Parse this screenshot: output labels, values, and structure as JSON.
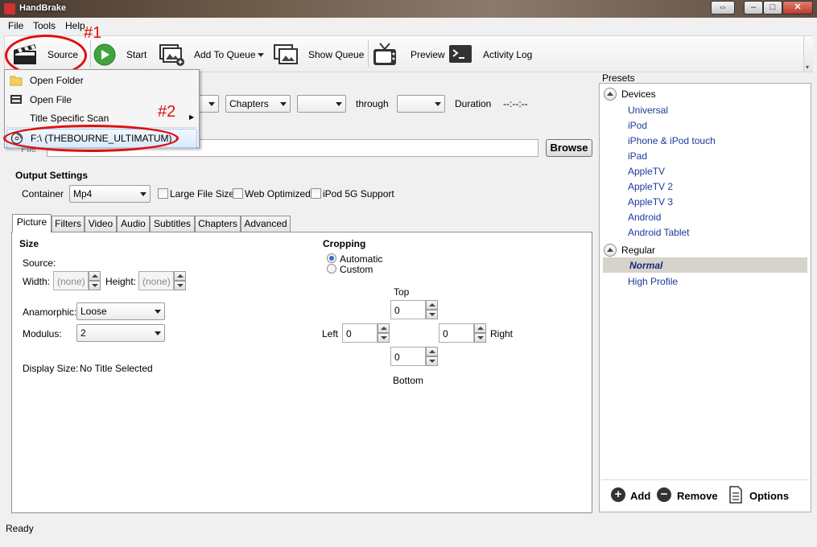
{
  "window": {
    "title": "HandBrake"
  },
  "menubar": {
    "items": [
      "File",
      "Tools",
      "Help"
    ]
  },
  "toolbar": {
    "source": "Source",
    "start": "Start",
    "add_to_queue": "Add To Queue",
    "show_queue": "Show Queue",
    "preview": "Preview",
    "activity_log": "Activity Log"
  },
  "annotations": {
    "one": "#1",
    "two": "#2"
  },
  "source_menu": {
    "open_folder": "Open Folder",
    "open_file": "Open File",
    "title_scan": "Title Specific Scan",
    "drive": "F:\\ (THEBOURNE_ULTIMATUM)"
  },
  "source_row": {
    "chapters": "Chapters",
    "through": "through",
    "duration_label": "Duration",
    "duration_value": "--:--:--"
  },
  "destination": {
    "label": "File",
    "browse": "Browse"
  },
  "output": {
    "heading": "Output Settings",
    "container_label": "Container",
    "container_value": "Mp4",
    "large_file": "Large File Size",
    "web_optimized": "Web Optimized",
    "ipod": "iPod 5G Support"
  },
  "tabs": [
    "Picture",
    "Filters",
    "Video",
    "Audio",
    "Subtitles",
    "Chapters",
    "Advanced"
  ],
  "picture": {
    "size_heading": "Size",
    "source_label": "Source:",
    "width_label": "Width:",
    "width_value": "(none)",
    "height_label": "Height:",
    "height_value": "(none)",
    "anamorphic_label": "Anamorphic:",
    "anamorphic_value": "Loose",
    "modulus_label": "Modulus:",
    "modulus_value": "2",
    "display_size_label": "Display Size:",
    "display_size_value": "No Title Selected"
  },
  "cropping": {
    "heading": "Cropping",
    "automatic": "Automatic",
    "custom": "Custom",
    "top_label": "Top",
    "top_value": "0",
    "left_label": "Left",
    "left_value": "0",
    "right_label": "Right",
    "right_value": "0",
    "bottom_label": "Bottom",
    "bottom_value": "0"
  },
  "presets": {
    "heading": "Presets",
    "devices_group": "Devices",
    "devices": [
      "Universal",
      "iPod",
      "iPhone & iPod touch",
      "iPad",
      "AppleTV",
      "AppleTV 2",
      "AppleTV 3",
      "Android",
      "Android Tablet"
    ],
    "regular_group": "Regular",
    "regular": [
      "Normal",
      "High Profile"
    ],
    "add": "Add",
    "remove": "Remove",
    "options": "Options"
  },
  "status": {
    "text": "Ready"
  },
  "colors": {
    "annotation_red": "#e01010",
    "preset_link": "#1a3a9a",
    "selected_preset_bg": "#d6d2cc"
  }
}
